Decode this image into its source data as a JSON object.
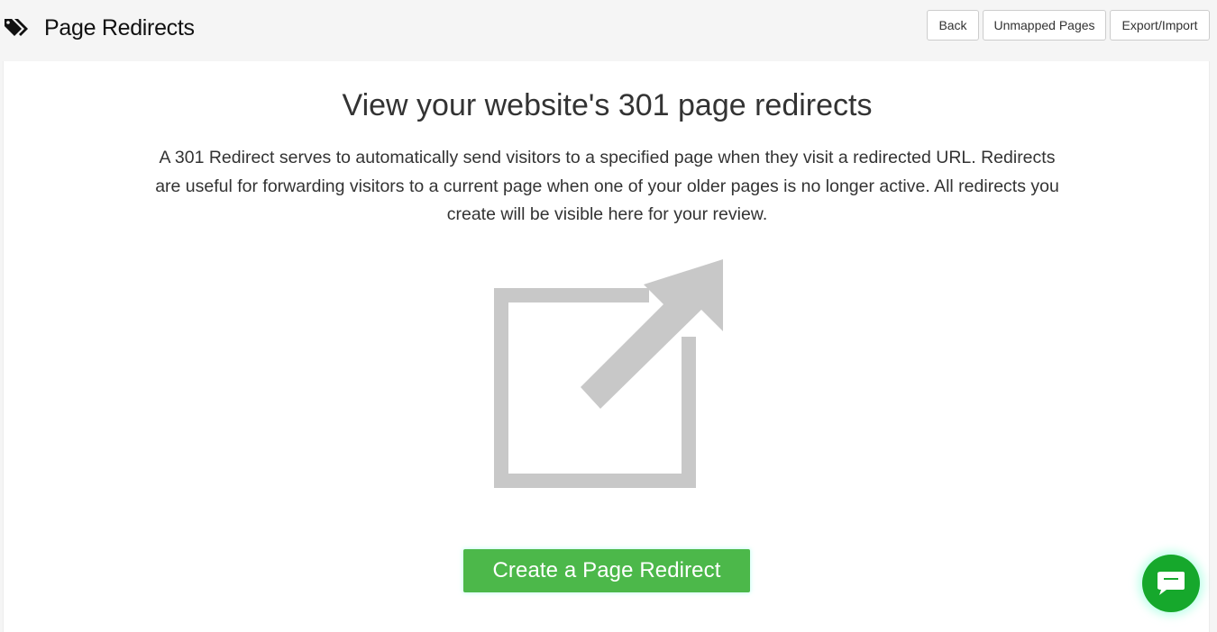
{
  "header": {
    "title": "Page Redirects",
    "title_icon": "tags-icon",
    "buttons": {
      "back": "Back",
      "unmapped": "Unmapped Pages",
      "export": "Export/Import"
    }
  },
  "main": {
    "heading": "View your website's 301 page redirects",
    "description": "A 301 Redirect serves to automatically send visitors to a specified page when they visit a redirected URL. Redirects are useful for forwarding visitors to a current page when one of your older pages is no longer active. All redirects you create will be visible here for your review.",
    "illustration_icon": "external-link-icon",
    "create_button": "Create a Page Redirect"
  },
  "chat": {
    "icon": "chat-bubble-icon"
  },
  "colors": {
    "primary_green": "#4cb84a",
    "chat_green": "#16a82c",
    "icon_gray": "#c8c8c8"
  }
}
